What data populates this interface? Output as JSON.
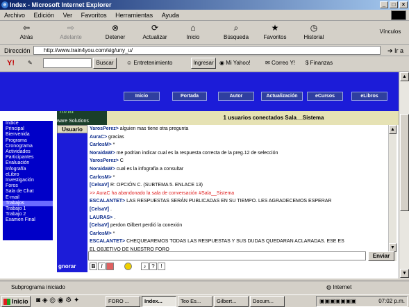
{
  "window": {
    "title": "Index - Microsoft Internet Explorer"
  },
  "menu": [
    "Archivo",
    "Edición",
    "Ver",
    "Favoritos",
    "Herramientas",
    "Ayuda"
  ],
  "toolbar": {
    "back": "Atrás",
    "forward": "Adelante",
    "stop": "Detener",
    "refresh": "Actualizar",
    "home": "Inicio",
    "search": "Búsqueda",
    "favorites": "Favoritos",
    "history": "Historial",
    "links": "Vínculos"
  },
  "address": {
    "label": "Dirección",
    "url": "http://www.train4you.com/sig/uny_u/",
    "go": "Ir a"
  },
  "yahoo": {
    "search_button": "Buscar",
    "entertainment": "Entretenimiento",
    "login": "Ingresar",
    "myyahoo": "Mi Yahoo!",
    "mail": "Correo Y!",
    "finance": "Finanzas"
  },
  "site": {
    "nav": [
      "Inicio",
      "Portada",
      "Autor",
      "Actualización",
      "eCursos",
      "eLibros"
    ],
    "logo_text": "ware Solutions",
    "logo_big": "ifina",
    "connected": "1 usuarios conectados Sala__Sistema",
    "user_tab": "Usuario",
    "ignore": "gnorar",
    "send": "Enviar",
    "sidebar": [
      "Indice",
      "Principal",
      "Bienvenida",
      "Programa",
      "Cronograma",
      "Actividades",
      "Participantes",
      "Evaluación",
      "Infografía",
      "eLibro",
      "Investigación",
      "Foros",
      "Sala de Chat",
      "E-mail",
      "Trabajos",
      "Trabajo 1",
      "Trabajo 2",
      "Examen Final"
    ],
    "sidebar_selected": "Trabajos"
  },
  "chat": [
    {
      "name": "YarosPerez>",
      "text": "alguien mas tiene otra pregunta"
    },
    {
      "name": "AuraC>",
      "text": "gracias"
    },
    {
      "name": "CarlosM>",
      "text": "*"
    },
    {
      "name": "NoraidaW>",
      "text": "me podrian indicar cual es la respuesta correcta de la preg.12 de selección"
    },
    {
      "name": "YarosPerez>",
      "text": "C"
    },
    {
      "name": "NoraidaW>",
      "text": "cual es la infografia a consultar"
    },
    {
      "name": "CarlosM>",
      "text": "*"
    },
    {
      "name": "[CelsaV]",
      "text": "R: OPCIÓN C. (SUBTEMA 5. ENLACE 13)"
    },
    {
      "name": "",
      "system": ">> AuraC ha abandonado la sala de conversación #Sala__Sistema"
    },
    {
      "name": "ESCALANTET>",
      "text": "LAS RESPUESTAS SERÁN PUBLICADAS EN SU TIEMPO. LES AGRADECEMOS ESPERAR"
    },
    {
      "name": "[CelsaV]",
      "text": "."
    },
    {
      "name": "LAURAS>",
      "text": "."
    },
    {
      "name": "[CelsaV]",
      "text": "perdon Gilbert perdió la conexión"
    },
    {
      "name": "CarlosM>",
      "text": "*"
    },
    {
      "name": "ESCALANTET>",
      "text": "CHEQUEAREMOS TODAS LAS RESPUESTAS Y SUS DUDAS QUEDARAN ACLARADAS. ESE ES"
    },
    {
      "name": "",
      "text": "EL OBJETIVO DE NUESTRO FORO"
    }
  ],
  "status": {
    "text": "Subprograma iniciado",
    "zone": "Internet"
  },
  "taskbar": {
    "start": "Inicio",
    "tasks": [
      "FORO ...",
      "Index...",
      "Teo Es...",
      "Gilbert...",
      "Docum..."
    ],
    "active": "Index...",
    "clock": "07:02 p.m."
  }
}
